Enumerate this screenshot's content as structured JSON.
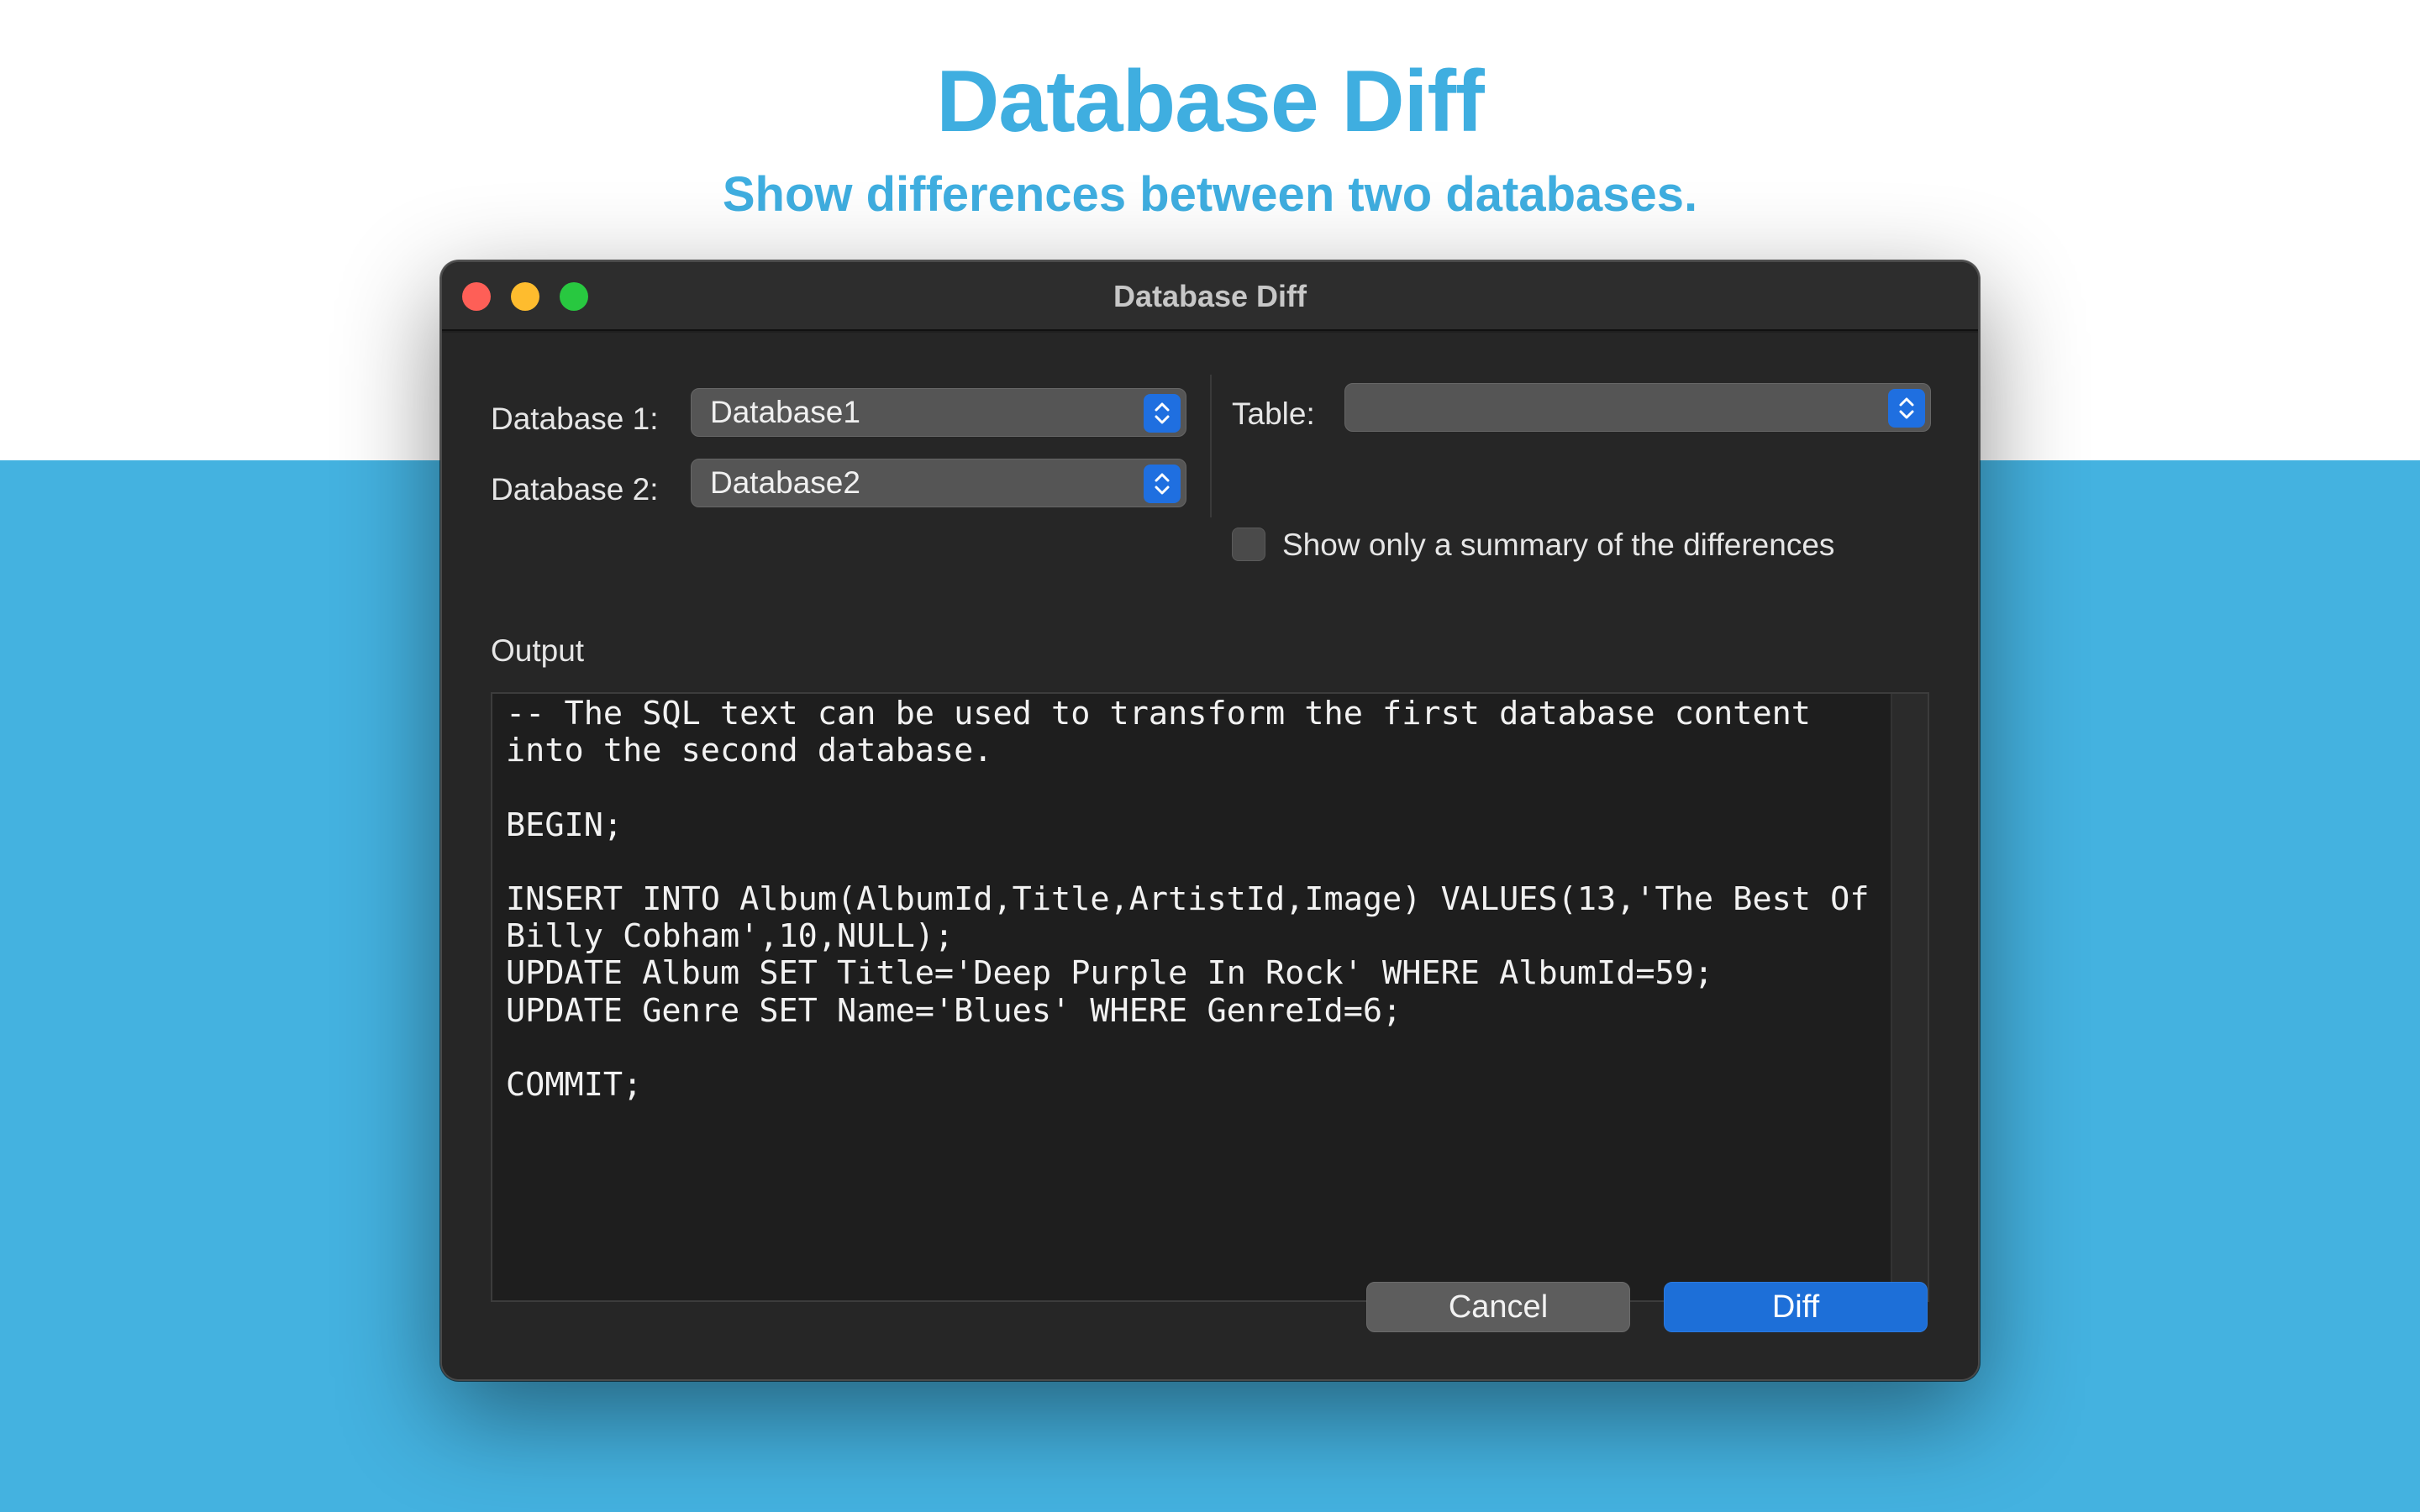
{
  "hero": {
    "title": "Database Diff",
    "subtitle": "Show differences between two databases."
  },
  "window": {
    "title": "Database Diff",
    "traffic_lights": [
      "close",
      "minimize",
      "zoom"
    ]
  },
  "form": {
    "db1_label": "Database 1:",
    "db1_value": "Database1",
    "db2_label": "Database 2:",
    "db2_value": "Database2",
    "table_label": "Table:",
    "table_value": "",
    "summary_checkbox_label": "Show only a summary of the differences",
    "summary_checked": false
  },
  "output": {
    "label": "Output",
    "text": "-- The SQL text can be used to transform the first database content\ninto the second database.\n\nBEGIN;\n\nINSERT INTO Album(AlbumId,Title,ArtistId,Image) VALUES(13,'The Best Of\nBilly Cobham',10,NULL);\nUPDATE Album SET Title='Deep Purple In Rock' WHERE AlbumId=59;\nUPDATE Genre SET Name='Blues' WHERE GenreId=6;\n\nCOMMIT;"
  },
  "buttons": {
    "cancel": "Cancel",
    "diff": "Diff"
  },
  "colors": {
    "accent": "#1f6fe0",
    "hero_text": "#3faee0",
    "band": "#44b2e0"
  }
}
